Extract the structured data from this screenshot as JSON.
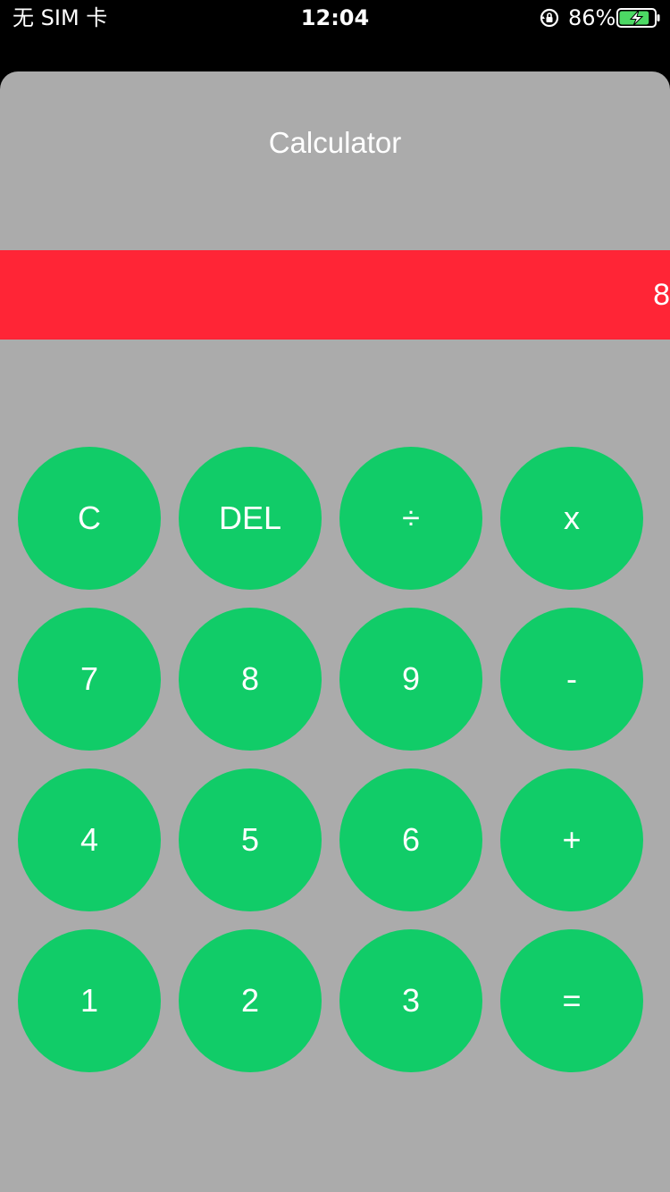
{
  "status_bar": {
    "carrier": "无 SIM 卡",
    "time": "12:04",
    "battery_percent": "86%",
    "lock_icon": "orientation-lock-icon",
    "battery_icon": "battery-charging-icon",
    "battery_level": 0.86,
    "battery_color": "#4cd964"
  },
  "app": {
    "title": "Calculator"
  },
  "display": {
    "value": "8",
    "background": "#ff2536"
  },
  "keypad": {
    "button_color": "#11cc68",
    "keys": {
      "clear": "C",
      "delete": "DEL",
      "divide": "÷",
      "multiply": "x",
      "seven": "7",
      "eight": "8",
      "nine": "9",
      "minus": "-",
      "four": "4",
      "five": "5",
      "six": "6",
      "plus": "+",
      "one": "1",
      "two": "2",
      "three": "3",
      "equals": "="
    }
  }
}
